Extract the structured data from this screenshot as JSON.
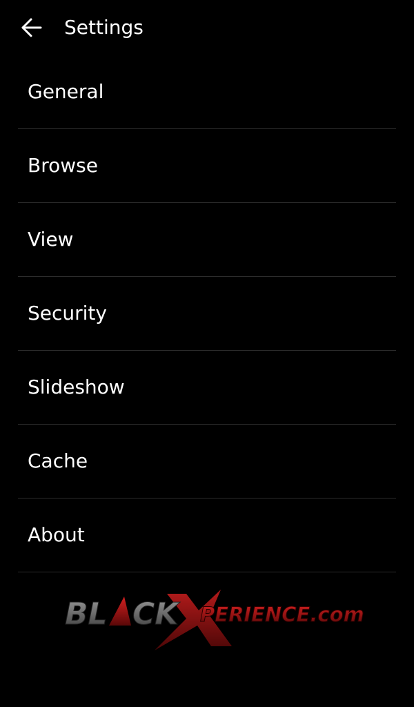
{
  "header": {
    "title": "Settings",
    "back_icon": "arrow-left-icon"
  },
  "settings": {
    "items": [
      {
        "label": "General"
      },
      {
        "label": "Browse"
      },
      {
        "label": "View"
      },
      {
        "label": "Security"
      },
      {
        "label": "Slideshow"
      },
      {
        "label": "Cache"
      },
      {
        "label": "About"
      }
    ]
  },
  "watermark": {
    "text": "BLACKXPERIENCE.com"
  },
  "colors": {
    "background": "#000000",
    "text": "#ffffff",
    "divider": "#2c2c2c",
    "watermark_red": "#b01818",
    "watermark_gray": "#6a6a6a"
  }
}
